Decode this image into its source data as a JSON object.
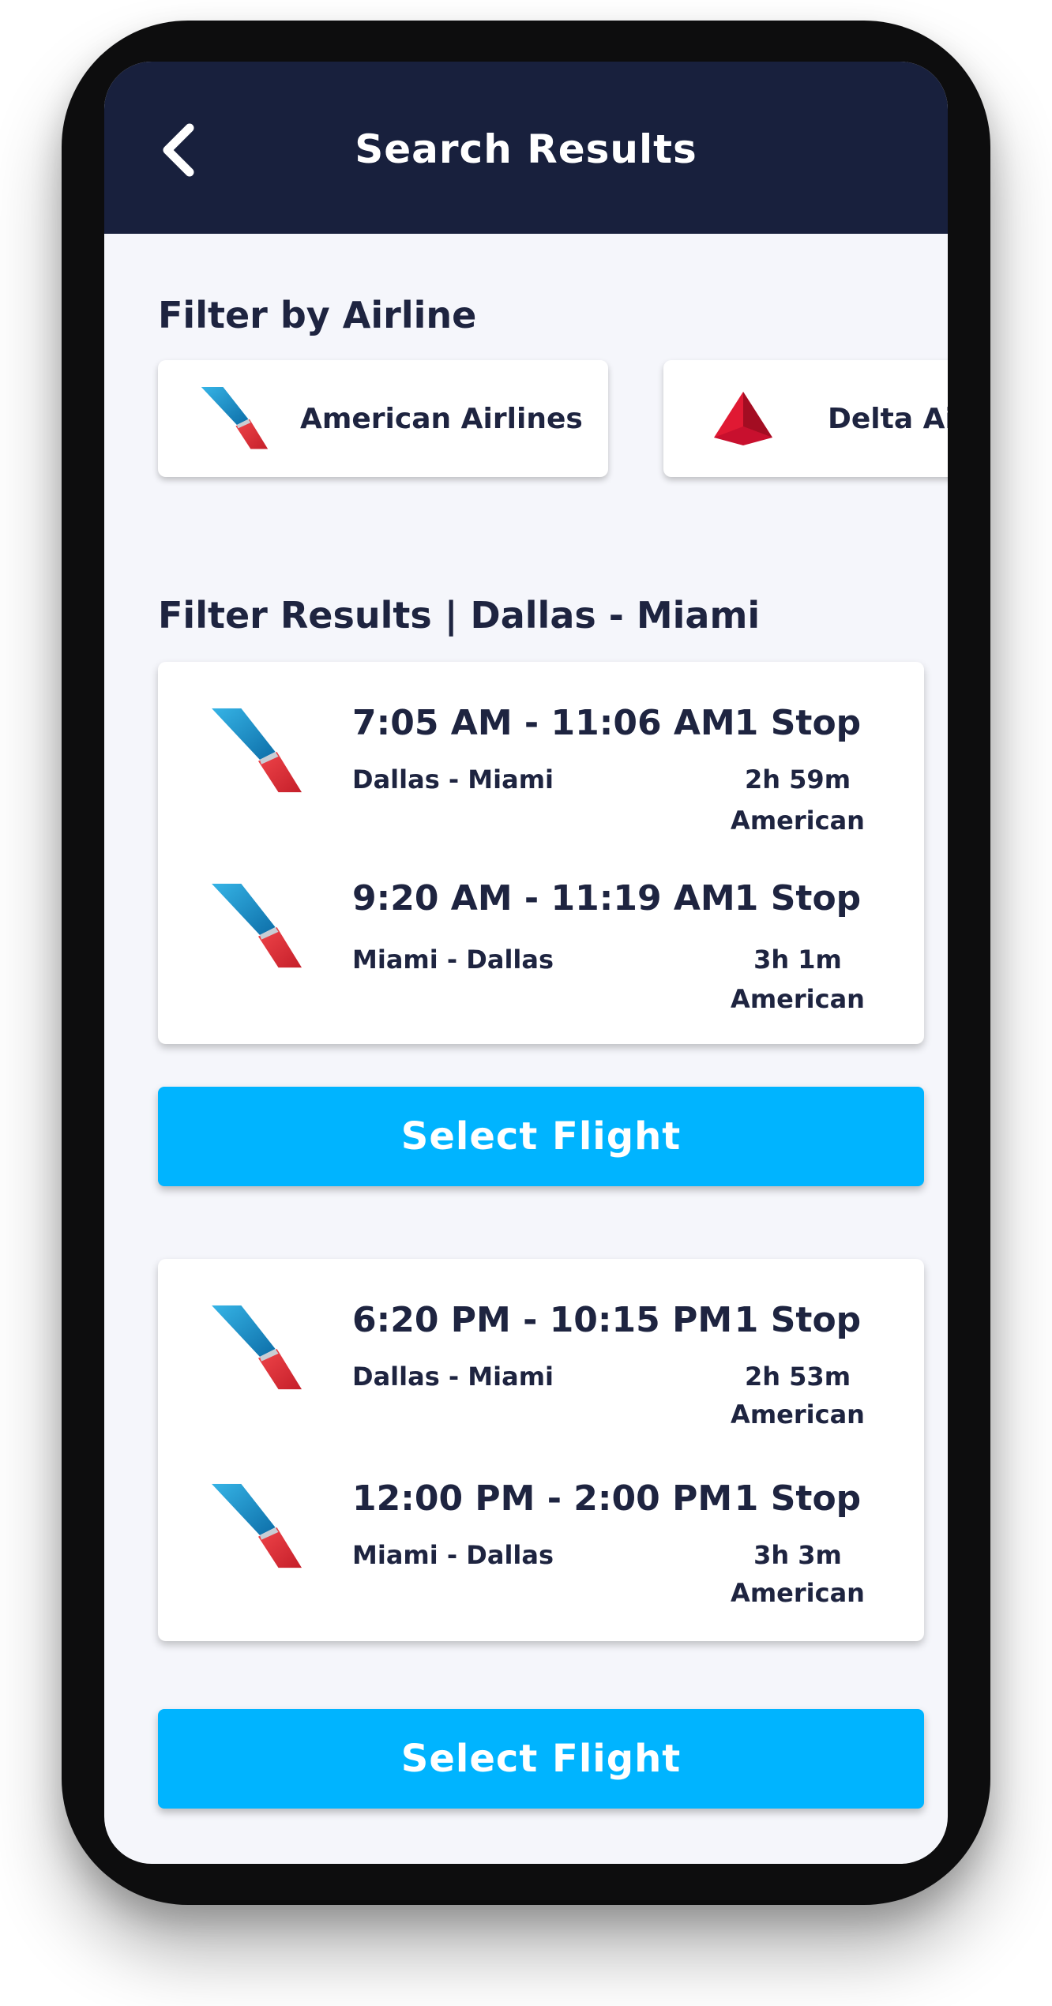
{
  "header": {
    "title": "Search Results",
    "back_icon": "chevron-left-icon"
  },
  "airline_filter": {
    "title": "Filter by Airline",
    "chips": [
      {
        "label": "American Airlines",
        "icon": "american-airlines-logo-icon"
      },
      {
        "label": "Delta Airlines",
        "icon": "delta-logo-icon"
      }
    ]
  },
  "results": {
    "title": "Filter Results | Dallas - Miami",
    "flights": [
      {
        "legs": [
          {
            "times": "7:05 AM - 11:06 AM",
            "route": "Dallas - Miami",
            "stops": "1 Stop",
            "duration": "2h 59m",
            "carrier": "American"
          },
          {
            "times": "9:20 AM - 11:19 AM",
            "route": "Miami - Dallas",
            "stops": "1 Stop",
            "duration": "3h 1m",
            "carrier": "American"
          }
        ],
        "button": "Select Flight"
      },
      {
        "legs": [
          {
            "times": "6:20 PM - 10:15 PM",
            "route": "Dallas - Miami",
            "stops": "1 Stop",
            "duration": "2h 53m",
            "carrier": "American"
          },
          {
            "times": "12:00 PM - 2:00 PM",
            "route": "Miami - Dallas",
            "stops": "1 Stop",
            "duration": "3h 3m",
            "carrier": "American"
          }
        ],
        "button": "Select Flight"
      }
    ]
  },
  "colors": {
    "header_bg": "#18203d",
    "accent": "#00b4ff",
    "text": "#1e2440",
    "screen_bg": "#f5f6fb"
  }
}
